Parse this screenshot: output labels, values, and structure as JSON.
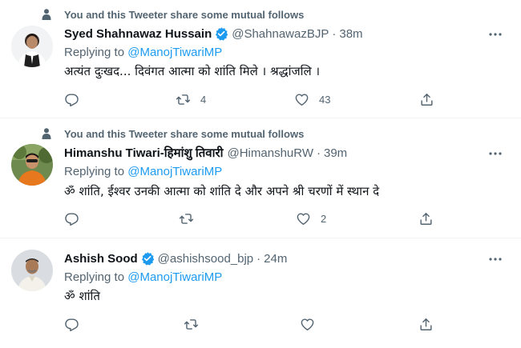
{
  "social_context": "You and this Tweeter share some mutual follows",
  "tweets": [
    {
      "show_social": true,
      "name": "Syed Shahnawaz Hussain",
      "handle": "@ShahnawazBJP",
      "time": "38m",
      "replying_prefix": "Replying to",
      "replying_to": "@ManojTiwariMP",
      "text": "अत्यंत दुःखद... दिवंगत आत्मा को शांति मिले । श्रद्धांजलि ।",
      "retweets": "4",
      "likes": "43",
      "verified": true
    },
    {
      "show_social": true,
      "name": "Himanshu Tiwari-हिमांशु तिवारी",
      "handle": "@HimanshuRW",
      "time": "39m",
      "replying_prefix": "Replying to",
      "replying_to": "@ManojTiwariMP",
      "text": "ॐ शांति, ईश्वर उनकी आत्मा को शांति दे और अपने श्री चरणों में स्थान दे",
      "retweets": "",
      "likes": "2",
      "verified": false
    },
    {
      "show_social": false,
      "name": "Ashish Sood",
      "handle": "@ashishsood_bjp",
      "time": "24m",
      "replying_prefix": "Replying to",
      "replying_to": "@ManojTiwariMP",
      "text": "ॐ शांति",
      "retweets": "",
      "likes": "",
      "verified": true
    }
  ],
  "icons": {
    "social": "person-icon",
    "verified": "verified-badge-icon",
    "more": "more-icon",
    "reply": "reply-icon",
    "retweet": "retweet-icon",
    "like": "heart-icon",
    "share": "share-icon"
  },
  "colors": {
    "accent": "#1d9bf0",
    "secondary_text": "#536471",
    "primary_text": "#0f1419",
    "divider": "#eff3f4"
  }
}
